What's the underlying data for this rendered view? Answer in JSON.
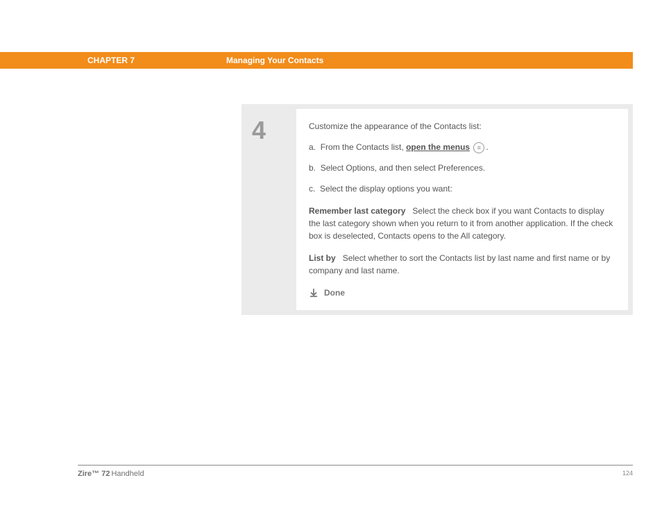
{
  "header": {
    "chapter": "CHAPTER 7",
    "section": "Managing Your Contacts"
  },
  "step": {
    "number": "4",
    "intro": "Customize the appearance of the Contacts list:",
    "items": {
      "a_prefix": "a.",
      "a_text1": "From the Contacts list, ",
      "a_link": "open the menus",
      "a_text2": ".",
      "b_prefix": "b.",
      "b_text": "Select Options, and then select Preferences.",
      "c_prefix": "c.",
      "c_text": "Select the display options you want:"
    },
    "options": {
      "remember_label": "Remember last category",
      "remember_text": "Select the check box if you want Contacts to display the last category shown when you return to it from another application. If the check box is deselected, Contacts opens to the All category.",
      "listby_label": "List by",
      "listby_text": "Select whether to sort the Contacts list by last name and first name or by company and last name."
    },
    "done": "Done"
  },
  "footer": {
    "brand": "Zire™ 72",
    "product": " Handheld",
    "page": "124"
  }
}
